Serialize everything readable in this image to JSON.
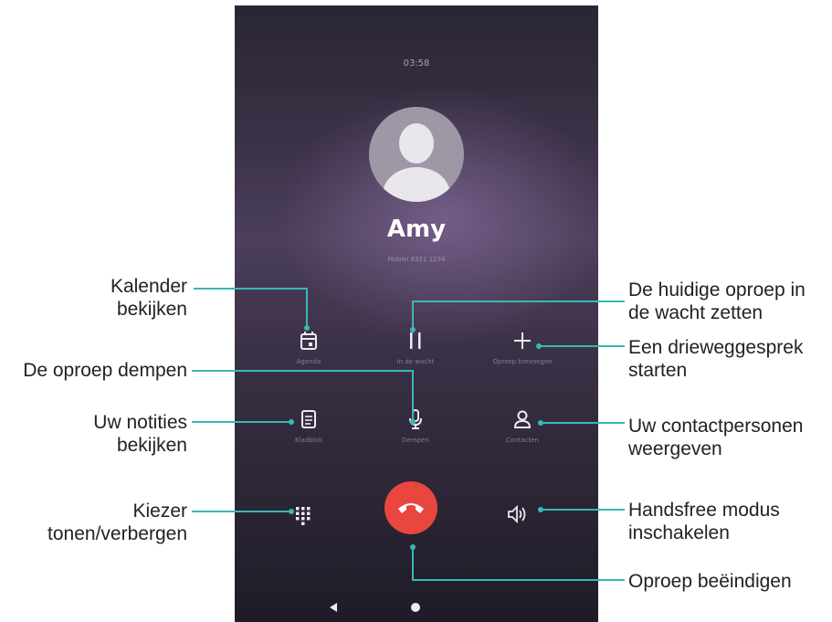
{
  "call": {
    "time": "03:58",
    "contact_name": "Amy",
    "contact_info": "Mobiel 8321 1234"
  },
  "buttons": {
    "agenda": {
      "label": "Agenda",
      "icon": "calendar-icon"
    },
    "hold": {
      "label": "In de wacht",
      "icon": "pause-icon"
    },
    "add_call": {
      "label": "Oproep toevoegen",
      "icon": "plus-icon"
    },
    "notes": {
      "label": "Kladblok",
      "icon": "notes-icon"
    },
    "mute": {
      "label": "Dempen",
      "icon": "microphone-icon"
    },
    "contacts": {
      "label": "Contacten",
      "icon": "contact-icon"
    },
    "dialpad": {
      "icon": "dialpad-icon"
    },
    "end_call": {
      "icon": "end-call-icon",
      "color": "#e8463e"
    },
    "speaker": {
      "icon": "speaker-icon"
    }
  },
  "navigation": {
    "back_icon": "back-icon",
    "home_icon": "home-icon"
  },
  "callouts": {
    "calendar": "Kalender bekijken",
    "mute": "De oproep dempen",
    "notes": "Uw notities bekijken",
    "dialpad": "Kiezer tonen/verbergen",
    "hold": "De huidige oproep in de wacht zetten",
    "add_call": "Een drieweggesprek starten",
    "contacts": "Uw contactpersonen weergeven",
    "speaker": "Handsfree modus inschakelen",
    "end_call": "Oproep beëindigen"
  },
  "colors": {
    "callout_line": "#3bb7b5",
    "end_call": "#e8463e"
  }
}
